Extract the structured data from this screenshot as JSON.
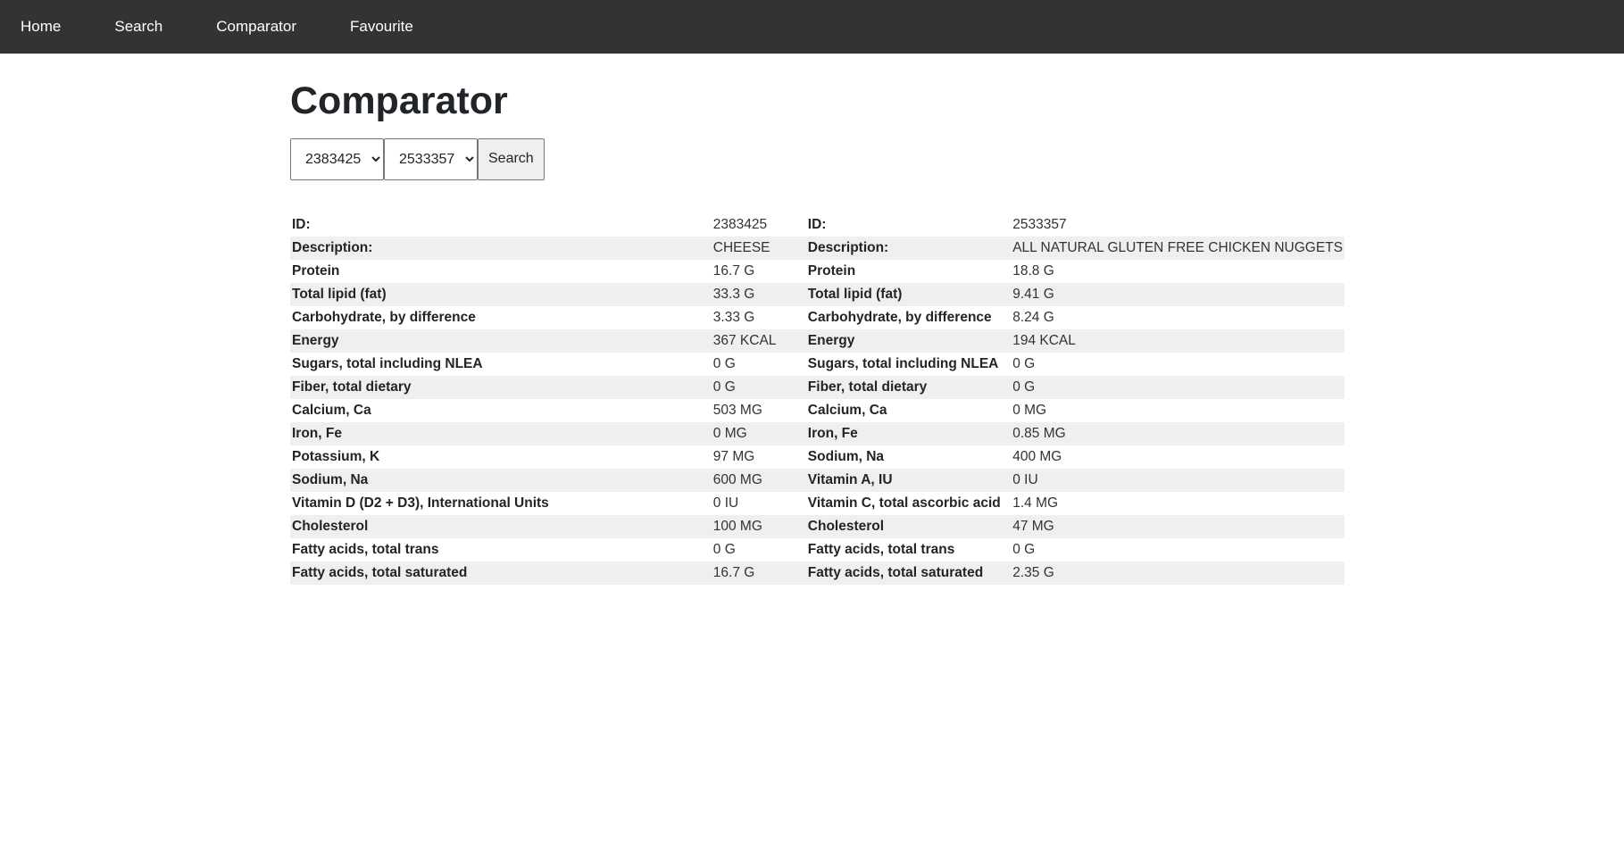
{
  "nav": {
    "items": [
      "Home",
      "Search",
      "Comparator",
      "Favourite"
    ]
  },
  "page": {
    "title": "Comparator"
  },
  "controls": {
    "select_a_value": "2383425",
    "select_b_value": "2533357",
    "search_label": "Search"
  },
  "comparison": {
    "rows": [
      {
        "a_label": "ID:",
        "a_value": "2383425",
        "b_label": "ID:",
        "b_value": "2533357"
      },
      {
        "a_label": "Description:",
        "a_value": "CHEESE",
        "b_label": "Description:",
        "b_value": "ALL NATURAL GLUTEN FREE CHICKEN NUGGETS"
      },
      {
        "a_label": "Protein",
        "a_value": "16.7 G",
        "b_label": "Protein",
        "b_value": "18.8 G"
      },
      {
        "a_label": "Total lipid (fat)",
        "a_value": "33.3 G",
        "b_label": "Total lipid (fat)",
        "b_value": "9.41 G"
      },
      {
        "a_label": "Carbohydrate, by difference",
        "a_value": "3.33 G",
        "b_label": "Carbohydrate, by difference",
        "b_value": "8.24 G"
      },
      {
        "a_label": "Energy",
        "a_value": "367 KCAL",
        "b_label": "Energy",
        "b_value": "194 KCAL"
      },
      {
        "a_label": "Sugars, total including NLEA",
        "a_value": "0 G",
        "b_label": "Sugars, total including NLEA",
        "b_value": "0 G"
      },
      {
        "a_label": "Fiber, total dietary",
        "a_value": "0 G",
        "b_label": "Fiber, total dietary",
        "b_value": "0 G"
      },
      {
        "a_label": "Calcium, Ca",
        "a_value": "503 MG",
        "b_label": "Calcium, Ca",
        "b_value": "0 MG"
      },
      {
        "a_label": "Iron, Fe",
        "a_value": "0 MG",
        "b_label": "Iron, Fe",
        "b_value": "0.85 MG"
      },
      {
        "a_label": "Potassium, K",
        "a_value": "97 MG",
        "b_label": "Sodium, Na",
        "b_value": "400 MG"
      },
      {
        "a_label": "Sodium, Na",
        "a_value": "600 MG",
        "b_label": "Vitamin A, IU",
        "b_value": "0 IU"
      },
      {
        "a_label": "Vitamin D (D2 + D3), International Units",
        "a_value": "0 IU",
        "b_label": "Vitamin C, total ascorbic acid",
        "b_value": "1.4 MG"
      },
      {
        "a_label": "Cholesterol",
        "a_value": "100 MG",
        "b_label": "Cholesterol",
        "b_value": "47 MG"
      },
      {
        "a_label": "Fatty acids, total trans",
        "a_value": "0 G",
        "b_label": "Fatty acids, total trans",
        "b_value": "0 G"
      },
      {
        "a_label": "Fatty acids, total saturated",
        "a_value": "16.7 G",
        "b_label": "Fatty acids, total saturated",
        "b_value": "2.35 G"
      }
    ]
  }
}
